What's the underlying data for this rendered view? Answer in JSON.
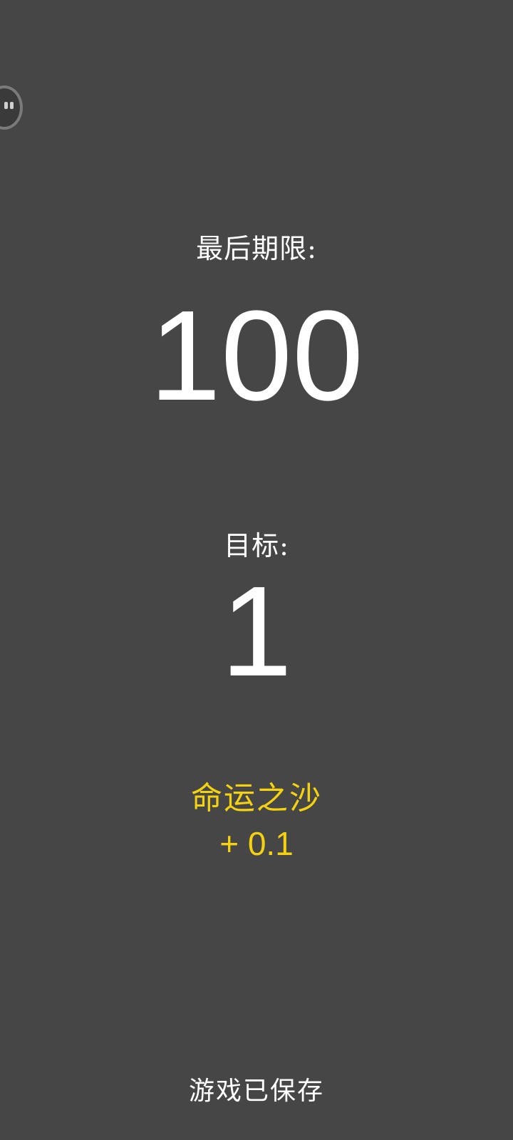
{
  "pause": {
    "icon": "pause-icon"
  },
  "deadline": {
    "label": "最后期限:",
    "value": "100"
  },
  "target": {
    "label": "目标:",
    "value": "1"
  },
  "bonus": {
    "name": "命运之沙",
    "value": "+ 0.1",
    "color": "#f5d20f"
  },
  "status": {
    "text": "游戏已保存"
  },
  "colors": {
    "background": "#464646",
    "text": "#ffffff"
  }
}
